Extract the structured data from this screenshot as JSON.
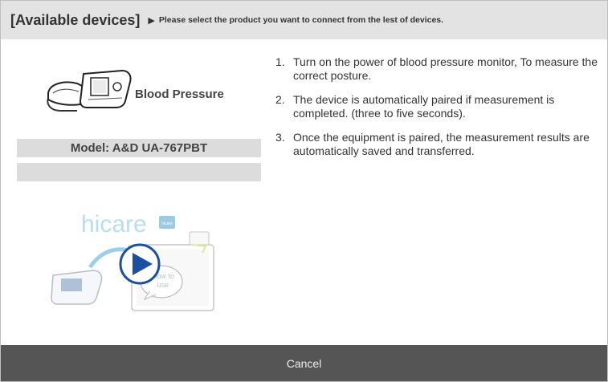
{
  "header": {
    "title": "[Available devices]",
    "arrow": "▶",
    "instruction": "Please select the product you want to connect from the lest of devices."
  },
  "device": {
    "icon": "blood-pressure-monitor-icon",
    "name": "Blood Pressure",
    "model": "Model: A&D UA-767PBT"
  },
  "steps": [
    {
      "num": "1.",
      "text": "Turn on the power of blood pressure monitor, To measure the correct posture."
    },
    {
      "num": "2.",
      "text": "The device is automatically paired if measurement is completed. (three to five seconds)."
    },
    {
      "num": "3.",
      "text": "Once the equipment is paired, the measurement results are automatically saved and transferred."
    }
  ],
  "video": {
    "brand": "hicare",
    "badge": "hicare",
    "caption_line1": "How to",
    "caption_line2": "use",
    "play_icon": "play-icon"
  },
  "footer": {
    "cancel_label": "Cancel"
  },
  "colors": {
    "header_bg": "#e3e3e3",
    "footer_bg": "#555555",
    "play_blue": "#1b4fa0"
  }
}
